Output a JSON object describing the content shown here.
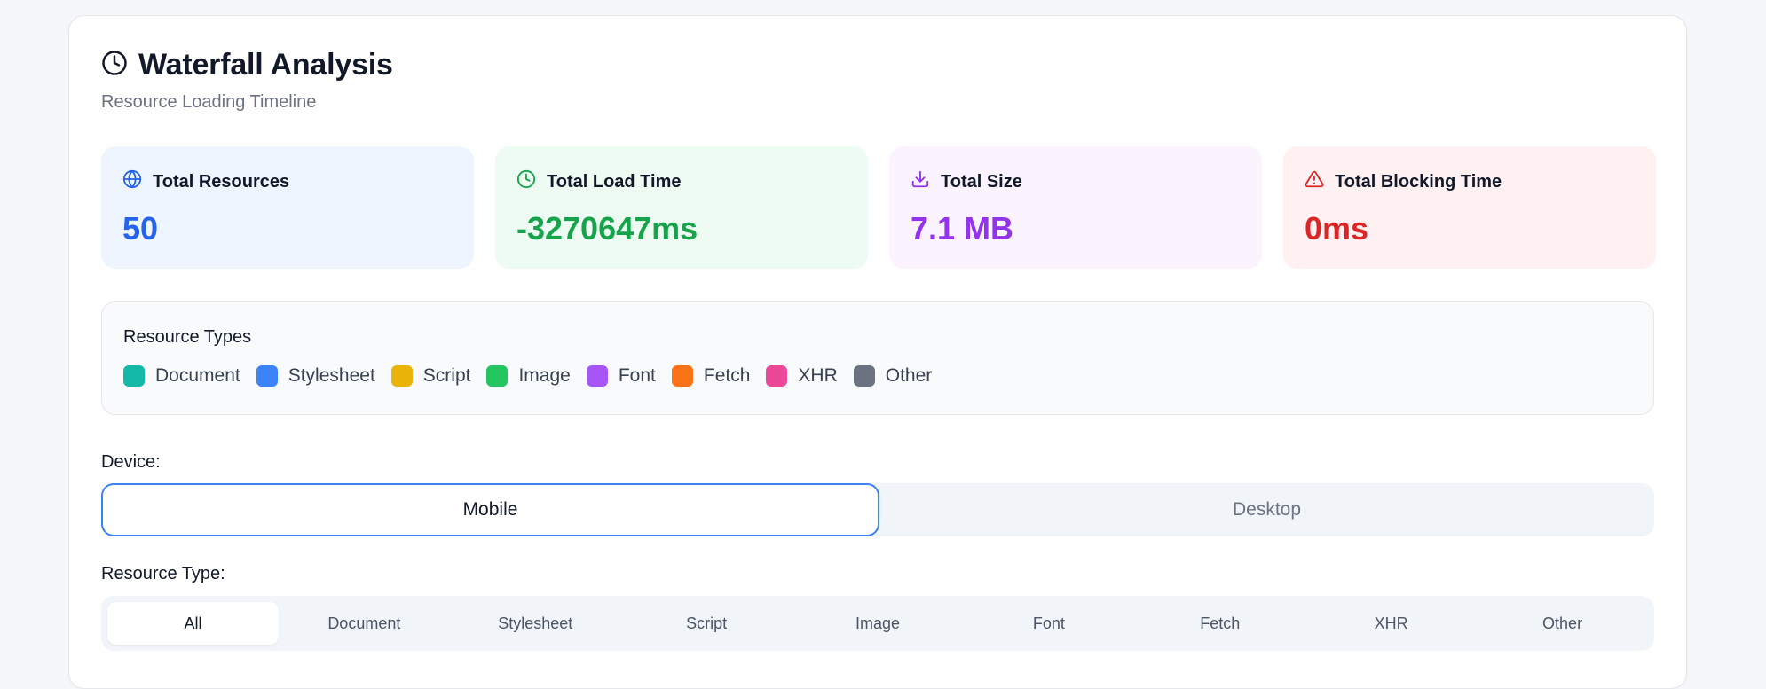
{
  "header": {
    "title": "Waterfall Analysis",
    "subtitle": "Resource Loading Timeline",
    "icon": "clock-icon"
  },
  "stats": [
    {
      "label": "Total Resources",
      "value": "50",
      "icon": "globe-icon",
      "color": "#2563eb"
    },
    {
      "label": "Total Load Time",
      "value": "-3270647ms",
      "icon": "clock-icon",
      "color": "#16a34a"
    },
    {
      "label": "Total Size",
      "value": "7.1 MB",
      "icon": "download-icon",
      "color": "#9333ea"
    },
    {
      "label": "Total Blocking Time",
      "value": "0ms",
      "icon": "warning-icon",
      "color": "#dc2626"
    }
  ],
  "legend": {
    "title": "Resource Types",
    "items": [
      {
        "label": "Document",
        "color": "#14b8a6"
      },
      {
        "label": "Stylesheet",
        "color": "#3b82f6"
      },
      {
        "label": "Script",
        "color": "#eab308"
      },
      {
        "label": "Image",
        "color": "#22c55e"
      },
      {
        "label": "Font",
        "color": "#a855f7"
      },
      {
        "label": "Fetch",
        "color": "#f97316"
      },
      {
        "label": "XHR",
        "color": "#ec4899"
      },
      {
        "label": "Other",
        "color": "#6b7280"
      }
    ]
  },
  "device": {
    "label": "Device:",
    "options": [
      "Mobile",
      "Desktop"
    ],
    "selected": "Mobile"
  },
  "resource_type": {
    "label": "Resource Type:",
    "options": [
      "All",
      "Document",
      "Stylesheet",
      "Script",
      "Image",
      "Font",
      "Fetch",
      "XHR",
      "Other"
    ],
    "selected": "All"
  }
}
